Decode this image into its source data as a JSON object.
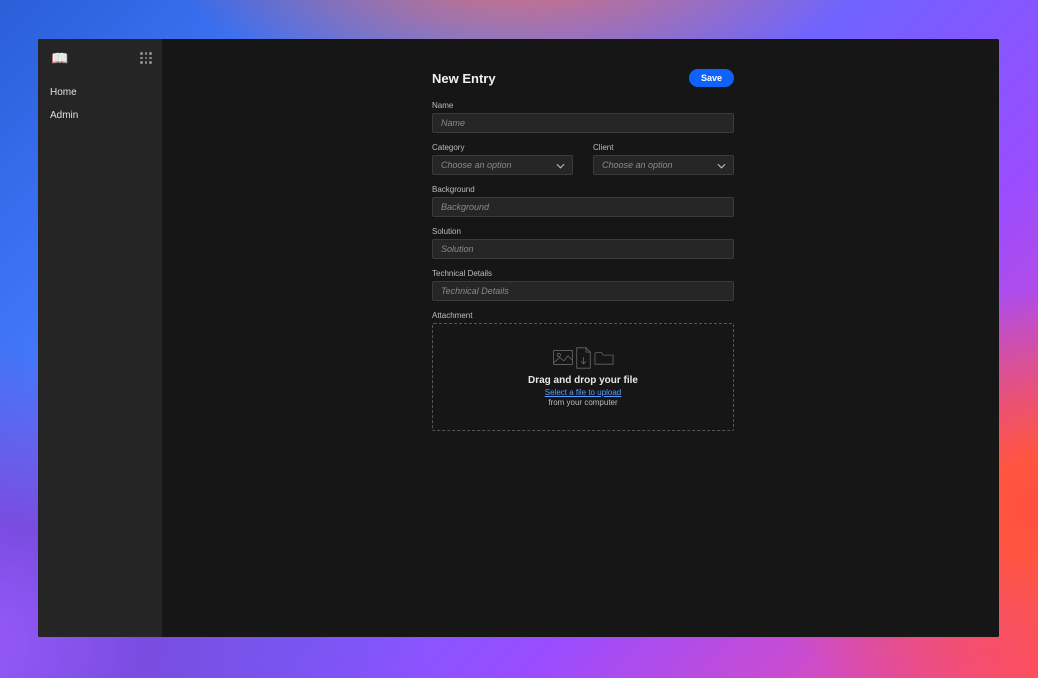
{
  "sidebar": {
    "logo_emoji": "📖",
    "items": [
      {
        "label": "Home"
      },
      {
        "label": "Admin"
      }
    ]
  },
  "header": {
    "title": "New Entry",
    "save_label": "Save"
  },
  "form": {
    "name": {
      "label": "Name",
      "placeholder": "Name",
      "value": ""
    },
    "category": {
      "label": "Category",
      "placeholder": "Choose an option",
      "selected": ""
    },
    "client": {
      "label": "Client",
      "placeholder": "Choose an option",
      "selected": ""
    },
    "background": {
      "label": "Background",
      "placeholder": "Background",
      "value": ""
    },
    "solution": {
      "label": "Solution",
      "placeholder": "Solution",
      "value": ""
    },
    "technical_details": {
      "label": "Technical Details",
      "placeholder": "Technical Details",
      "value": ""
    },
    "attachment": {
      "label": "Attachment",
      "drop_text": "Drag and drop your file",
      "select_text": "Select a file to upload",
      "from_text": "from your computer"
    }
  },
  "colors": {
    "primary": "#0f62fe",
    "link": "#5a9bff",
    "bg_app": "#161616",
    "bg_sidebar": "#252525",
    "bg_input": "#262626"
  }
}
